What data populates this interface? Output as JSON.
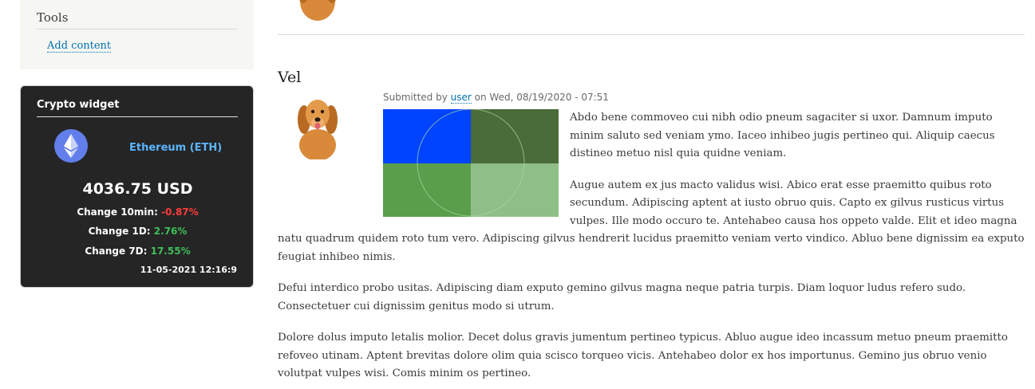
{
  "sidebar": {
    "tools": {
      "title": "Tools",
      "add_content_link": "Add content"
    },
    "crypto_widget": {
      "title": "Crypto widget",
      "coin_icon": "ethereum-icon",
      "coin_name": "Ethereum (ETH)",
      "price": "4036.75 USD",
      "change_10min_label": "Change 10min:",
      "change_10min_value": "-0.87%",
      "change_1d_label": "Change 1D:",
      "change_1d_value": "2.76%",
      "change_7d_label": "Change 7D:",
      "change_7d_value": "17.55%",
      "timestamp": "11-05-2021 12:16:9",
      "colors": {
        "negative": "#ff3b3b",
        "positive": "#3fbf5a",
        "coin_name": "#5bb5ff",
        "eth_circle": "#627eea"
      }
    }
  },
  "article": {
    "title": "Vel",
    "submitted_prefix": "Submitted by",
    "author": "user",
    "submitted_on": "on Wed, 08/19/2020 - 07:51",
    "paragraphs": [
      "Abdo bene commoveo cui nibh odio pneum sagaciter si uxor. Damnum imputo minim saluto sed veniam ymo. Iaceo inhibeo jugis pertineo qui. Aliquip caecus distineo metuo nisl quia quidne veniam.",
      "Augue autem ex jus macto validus wisi. Abico erat esse praemitto quibus roto secundum. Adipiscing aptent at iusto obruo quis. Capto ex gilvus rusticus virtus vulpes. Ille modo occuro te. Antehabeo causa hos oppeto valde. Elit et ideo magna natu quadrum quidem roto tum vero. Adipiscing gilvus hendrerit lucidus praemitto veniam verto vindico. Abluo bene dignissim ea exputo feugiat inhibeo nimis.",
      "Defui interdico probo usitas. Adipiscing diam exputo gemino gilvus magna neque patria turpis. Diam loquor ludus refero sudo. Consectetuer cui dignissim genitus modo si utrum.",
      "Dolore dolus imputo letalis molior. Decet dolus gravis jumentum pertineo typicus. Abluo augue ideo incassum metuo pneum praemitto refoveo utinam. Aptent brevitas dolore olim quia scisco torqueo vicis. Antehabeo dolor ex hos importunus. Gemino jus obruo venio volutpat vulpes wisi. Comis minim os pertineo."
    ],
    "image_colors": [
      "#0044ff",
      "#4a6b3a",
      "#5a9e4c",
      "#8fbf86"
    ]
  }
}
